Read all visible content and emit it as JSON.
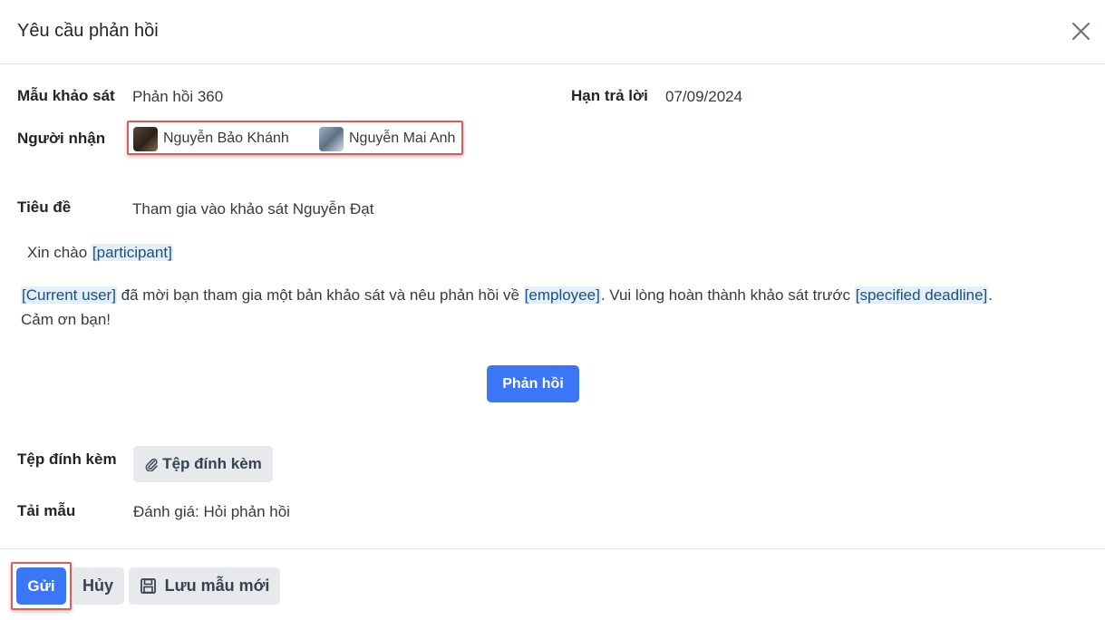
{
  "dialog": {
    "title": "Yêu cầu phản hồi"
  },
  "fields": {
    "survey_label": "Mẫu khảo sát",
    "survey_value": "Phản hồi 360",
    "deadline_label": "Hạn trả lời",
    "deadline_value": "07/09/2024",
    "recipients_label": "Người nhận",
    "recipients": [
      {
        "name": "Nguyễn Bảo Khánh"
      },
      {
        "name": "Nguyễn Mai Anh"
      }
    ],
    "subject_label": "Tiêu đề",
    "subject_value": "Tham gia vào khảo sát Nguyễn Đạt",
    "attachment_label": "Tệp đính kèm",
    "attachment_button": "Tệp đính kèm",
    "template_label": "Tải mẫu",
    "template_value": "Đánh giá: Hỏi phản hồi"
  },
  "message": {
    "greeting": "Xin chào",
    "participant_tag": "[participant]",
    "current_user_tag": "[Current user]",
    "text_1": " đã mời bạn tham gia một bản khảo sát và nêu phản hồi về ",
    "employee_tag": "[employee]",
    "text_2": ". Vui lòng hoàn thành khảo sát trước ",
    "deadline_tag": "[specified deadline]",
    "text_3": ".",
    "thanks": "Cảm ơn bạn!",
    "feedback_button": "Phản hồi"
  },
  "footer": {
    "send_button": "Gửi",
    "cancel_button": "Hủy",
    "save_template_button": "Lưu mẫu mới"
  },
  "colors": {
    "primary": "#3b76f6",
    "secondary": "#e7e9ed",
    "highlight": "#e05a5a",
    "placeholder_bg": "#e3f0fb"
  },
  "icons": [
    "close-icon",
    "paperclip-icon",
    "save-icon"
  ]
}
